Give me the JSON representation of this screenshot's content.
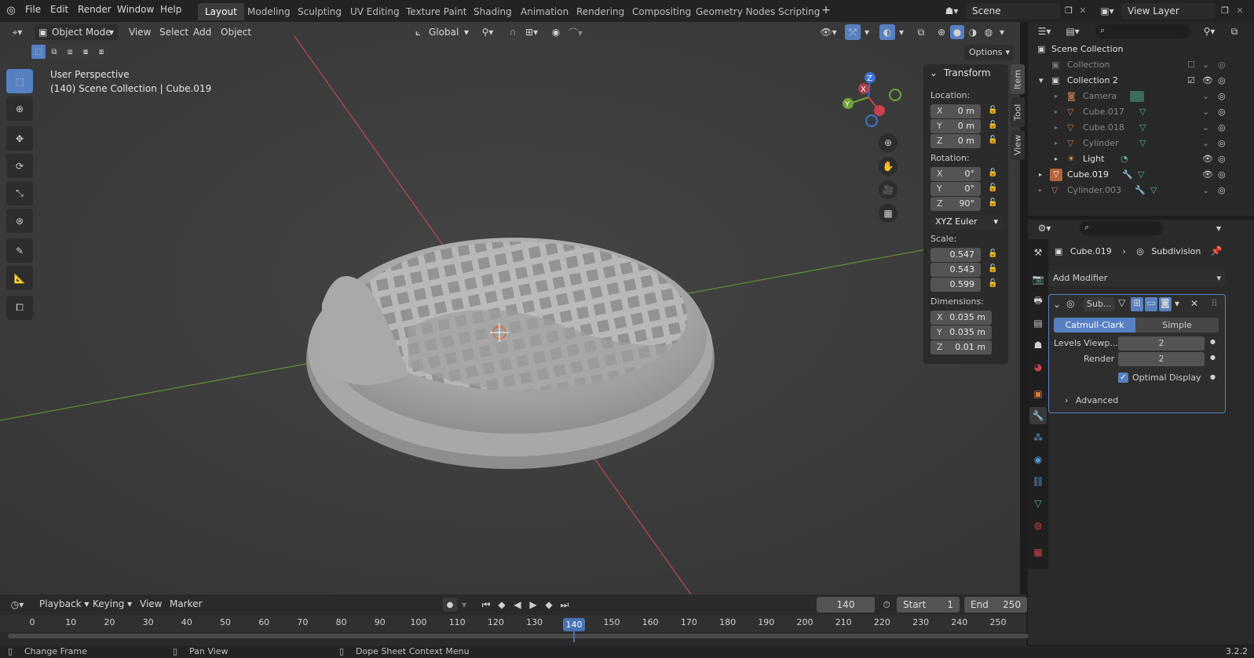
{
  "topbar": {
    "menus": [
      "File",
      "Edit",
      "Render",
      "Window",
      "Help"
    ],
    "tabs": [
      "Layout",
      "Modeling",
      "Sculpting",
      "UV Editing",
      "Texture Paint",
      "Shading",
      "Animation",
      "Rendering",
      "Compositing",
      "Geometry Nodes",
      "Scripting"
    ],
    "active_tab": "Layout",
    "scene": "Scene",
    "view_layer": "View Layer"
  },
  "viewport_header": {
    "mode": "Object Mode",
    "menus": [
      "View",
      "Select",
      "Add",
      "Object"
    ],
    "transform_orientation": "Global",
    "options": "Options"
  },
  "viewport": {
    "perspective": "User Perspective",
    "context": "(140) Scene Collection | Cube.019"
  },
  "npanel": {
    "section": "Transform",
    "location_label": "Location:",
    "location": [
      {
        "axis": "X",
        "value": "0 m"
      },
      {
        "axis": "Y",
        "value": "0 m"
      },
      {
        "axis": "Z",
        "value": "0 m"
      }
    ],
    "rotation_label": "Rotation:",
    "rotation": [
      {
        "axis": "X",
        "value": "0°"
      },
      {
        "axis": "Y",
        "value": "0°"
      },
      {
        "axis": "Z",
        "value": "90°"
      }
    ],
    "rotation_mode": "XYZ Euler",
    "scale_label": "Scale:",
    "scale": [
      "0.547",
      "0.543",
      "0.599"
    ],
    "dimensions_label": "Dimensions:",
    "dimensions": [
      {
        "axis": "X",
        "value": "0.035 m"
      },
      {
        "axis": "Y",
        "value": "0.035 m"
      },
      {
        "axis": "Z",
        "value": "0.01 m"
      }
    ],
    "side_tabs": [
      "Item",
      "Tool",
      "View"
    ]
  },
  "outliner": {
    "root": "Scene Collection",
    "rows": [
      {
        "name": "Collection",
        "dim": true
      },
      {
        "name": "Collection 2",
        "dim": false
      },
      {
        "name": "Camera",
        "dim": true
      },
      {
        "name": "Cube.017",
        "dim": true
      },
      {
        "name": "Cube.018",
        "dim": true
      },
      {
        "name": "Cylinder",
        "dim": true
      },
      {
        "name": "Light",
        "dim": false
      },
      {
        "name": "Cube.019",
        "dim": false
      },
      {
        "name": "Cylinder.003",
        "dim": true
      }
    ]
  },
  "properties": {
    "object": "Cube.019",
    "modifier_breadcrumb": "Subdivision",
    "add_modifier": "Add Modifier",
    "modifier_name": "Sub...",
    "catmull": "Catmull-Clark",
    "simple": "Simple",
    "levels_label": "Levels Viewp...",
    "levels_value": "2",
    "render_label": "Render",
    "render_value": "2",
    "optimal": "Optimal Display",
    "advanced": "Advanced"
  },
  "timeline": {
    "menus": [
      "Playback",
      "Keying",
      "View",
      "Marker"
    ],
    "current_frame": "140",
    "start_label": "Start",
    "start": "1",
    "end_label": "End",
    "end": "250",
    "ticks": [
      "0",
      "10",
      "20",
      "30",
      "40",
      "50",
      "60",
      "70",
      "80",
      "90",
      "100",
      "110",
      "120",
      "130",
      "140",
      "150",
      "160",
      "170",
      "180",
      "190",
      "200",
      "210",
      "220",
      "230",
      "240",
      "250"
    ]
  },
  "status": {
    "change_frame": "Change Frame",
    "pan_view": "Pan View",
    "context_menu": "Dope Sheet Context Menu",
    "version": "3.2.2"
  },
  "colors": {
    "accent": "#5680c2",
    "x_axis": "#c8414b",
    "y_axis": "#6fa33a",
    "z_axis": "#3c73d6"
  }
}
